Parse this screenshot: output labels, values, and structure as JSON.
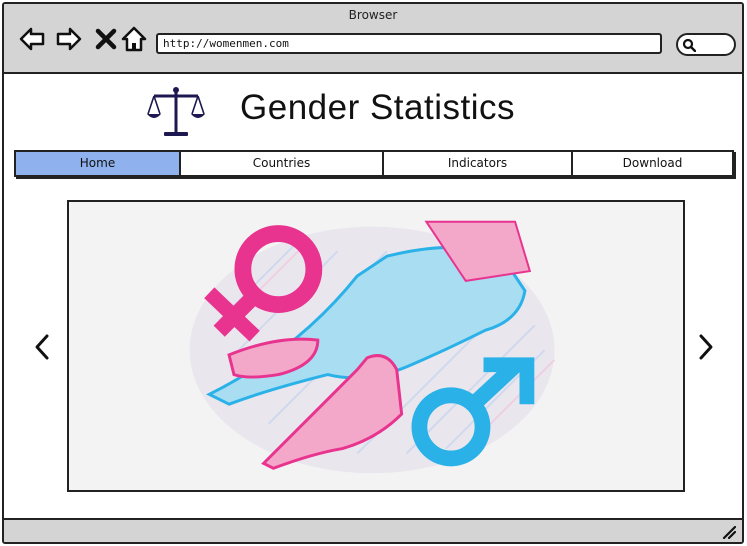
{
  "window": {
    "title": "Browser"
  },
  "toolbar": {
    "back_icon": "arrow-left-icon",
    "forward_icon": "arrow-right-icon",
    "close_icon": "x-icon",
    "home_icon": "home-icon",
    "url": "http://womenmen.com",
    "search_icon": "magnifier-icon"
  },
  "site": {
    "logo_icon": "balance-scale-icon",
    "title": "Gender Statistics"
  },
  "menu": {
    "items": [
      {
        "label": "Home",
        "active": true
      },
      {
        "label": "Countries",
        "active": false
      },
      {
        "label": "Indicators",
        "active": false
      },
      {
        "label": "Download",
        "active": false
      }
    ]
  },
  "carousel": {
    "image": "gender-symbols-handshake-illustration",
    "prev_icon": "chevron-left-icon",
    "next_icon": "chevron-right-icon"
  },
  "colors": {
    "chrome": "#d4d4d4",
    "active_tab": "#8fb2ef",
    "female_pink": "#e8338f",
    "male_blue": "#2ab2e8"
  }
}
